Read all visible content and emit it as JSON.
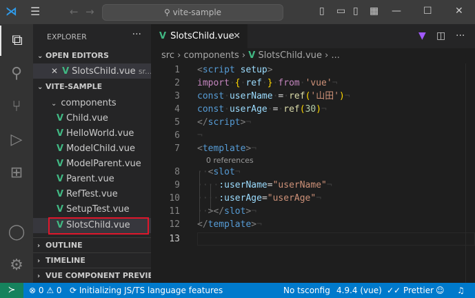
{
  "titlebar": {
    "search_text": "vite-sample",
    "logo_icon": "vscode-logo-icon"
  },
  "sidebar": {
    "title": "EXPLORER",
    "open_editors_label": "OPEN EDITORS",
    "open_editor_file": "SlotsChild.vue",
    "open_editor_path": "sr...",
    "project_label": "VITE-SAMPLE",
    "folder": "components",
    "files": [
      "Child.vue",
      "HelloWorld.vue",
      "ModelChild.vue",
      "ModelParent.vue",
      "Parent.vue",
      "RefTest.vue",
      "SetupTest.vue",
      "SlotsChild.vue"
    ],
    "outline_label": "OUTLINE",
    "timeline_label": "TIMELINE",
    "preview_label": "VUE COMPONENT PREVIEW"
  },
  "tab": {
    "label": "SlotsChild.vue"
  },
  "breadcrumb": {
    "part1": "src",
    "part2": "components",
    "part3": "SlotsChild.vue",
    "part4": "..."
  },
  "editor": {
    "line_numbers": [
      "1",
      "2",
      "3",
      "4",
      "5",
      "6",
      "7",
      "8",
      "9",
      "10",
      "11",
      "12",
      "13"
    ],
    "codelens": "0 references",
    "current_line": "13"
  },
  "status": {
    "problems_errors": "0",
    "problems_warnings": "0",
    "message": "Initializing JS/TS language features",
    "tsconfig": "No tsconfig",
    "version": "4.9.4 (vue)",
    "prettier": "Prettier"
  },
  "colors": {
    "accent": "#007acc",
    "vue": "#41b883",
    "highlight": "#e0162b"
  }
}
